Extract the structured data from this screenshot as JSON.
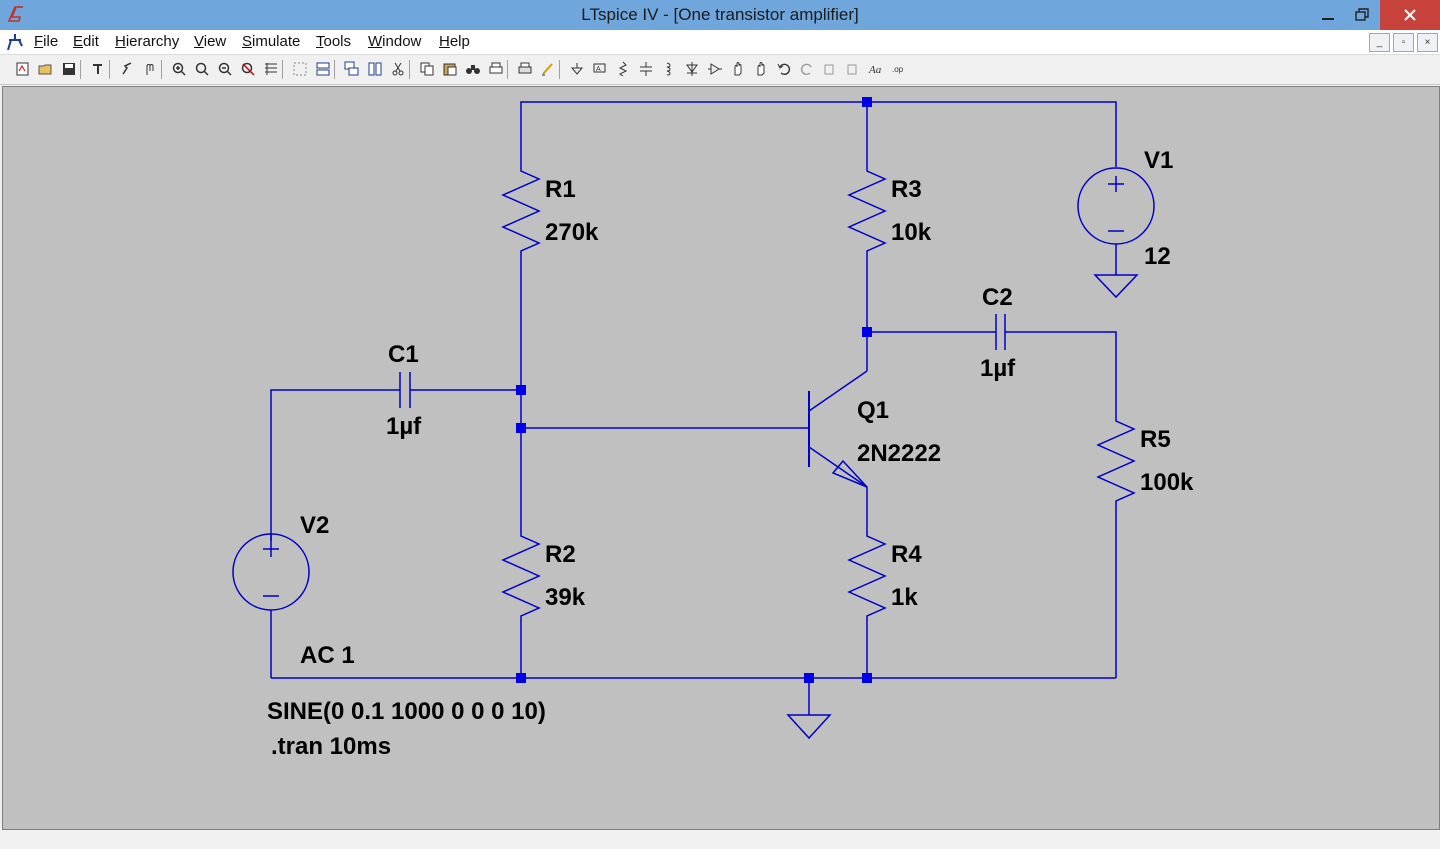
{
  "window": {
    "title": "LTspice IV - [One transistor amplifier]"
  },
  "menu": {
    "items": [
      "File",
      "Edit",
      "Hierarchy",
      "View",
      "Simulate",
      "Tools",
      "Window",
      "Help"
    ],
    "access_keys": [
      "F",
      "E",
      "H",
      "V",
      "S",
      "T",
      "W",
      "H"
    ]
  },
  "toolbar": {
    "icons": [
      "new-schematic-icon",
      "open-icon",
      "save-icon",
      "control-panel-icon",
      "run-icon",
      "halt-icon",
      "zoom-in-icon",
      "zoom-full-icon",
      "zoom-out-icon",
      "zoom-cancel-icon",
      "autorange-icon",
      "grid-icon",
      "tile-horizontal-icon",
      "cascade-icon",
      "tile-vertical-icon",
      "cut-icon",
      "copy-icon",
      "paste-icon",
      "find-icon",
      "print-setup-icon",
      "print-icon",
      "wire-icon",
      "ground-icon",
      "label-net-icon",
      "resistor-icon",
      "capacitor-icon",
      "inductor-icon",
      "diode-icon",
      "component-icon",
      "move-icon",
      "drag-icon",
      "undo-icon",
      "redo-icon",
      "rotate-icon",
      "mirror-icon",
      "text-icon",
      "spice-directive-icon"
    ]
  },
  "schematic": {
    "wire_color": "#0000c8",
    "components": {
      "R1": {
        "name": "R1",
        "value": "270k"
      },
      "R2": {
        "name": "R2",
        "value": "39k"
      },
      "R3": {
        "name": "R3",
        "value": "10k"
      },
      "R4": {
        "name": "R4",
        "value": "1k"
      },
      "R5": {
        "name": "R5",
        "value": "100k"
      },
      "C1": {
        "name": "C1",
        "value": "1µf"
      },
      "C2": {
        "name": "C2",
        "value": "1µf"
      },
      "Q1": {
        "name": "Q1",
        "value": "2N2222"
      },
      "V1": {
        "name": "V1",
        "value": "12"
      },
      "V2": {
        "name": "V2",
        "value": "AC 1",
        "value2": "SINE(0 0.1 1000 0 0 0 10)"
      }
    },
    "directive": ".tran 10ms"
  }
}
